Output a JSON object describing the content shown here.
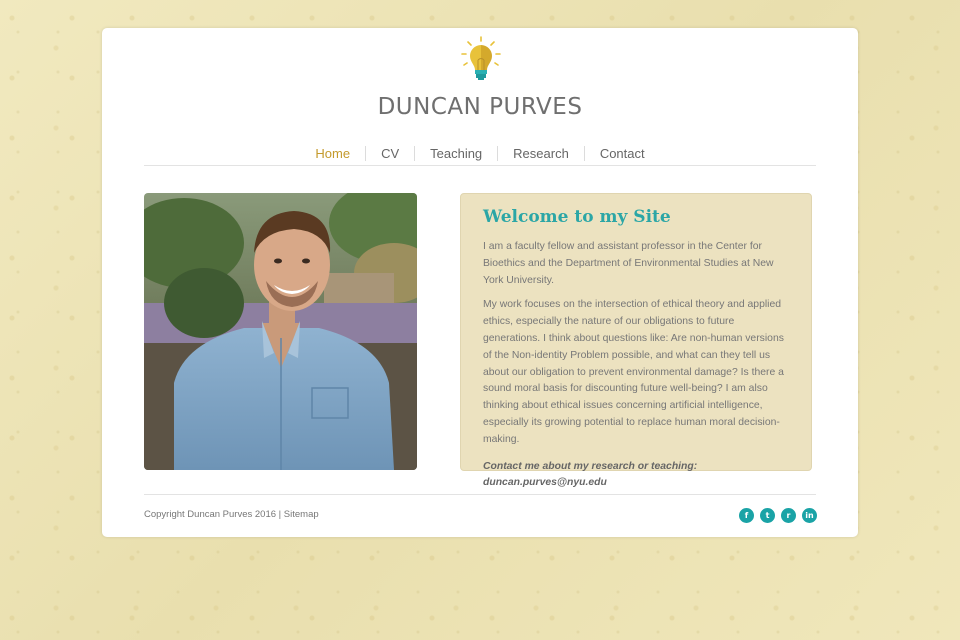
{
  "site": {
    "title": "DUNCAN PURVES",
    "logo_icon": "lightbulb-icon",
    "accent_color": "#c49a2c",
    "teal_color": "#1aa3a6"
  },
  "nav": {
    "items": [
      {
        "label": "Home",
        "active": true
      },
      {
        "label": "CV",
        "active": false
      },
      {
        "label": "Teaching",
        "active": false
      },
      {
        "label": "Research",
        "active": false
      },
      {
        "label": "Contact",
        "active": false
      }
    ]
  },
  "welcome": {
    "heading": "Welcome to my Site",
    "paragraph1": "I am a faculty fellow and assistant professor in the Center for Bioethics and the Department of Environmental Studies at New York University.",
    "paragraph2": "My work focuses on the intersection of ethical theory and applied ethics, especially the nature of our obligations to future generations. I think about questions like: Are non-human versions of the Non-identity Problem possible, and what can they tell us about our obligation to prevent environmental damage? Is there a sound moral basis for discounting future well-being? I am also thinking about ethical issues concerning artificial intelligence, especially its growing potential to replace human moral decision-making.",
    "contact": "Contact me about my research or teaching: duncan.purves@nyu.edu"
  },
  "footer": {
    "copyright": "Copyright Duncan Purves 2016 |",
    "sitemap": "Sitemap",
    "social": [
      {
        "icon": "facebook-icon",
        "glyph": "f"
      },
      {
        "icon": "twitter-icon",
        "glyph": "t"
      },
      {
        "icon": "rss-icon",
        "glyph": "r"
      },
      {
        "icon": "linkedin-icon",
        "glyph": "in"
      }
    ]
  }
}
